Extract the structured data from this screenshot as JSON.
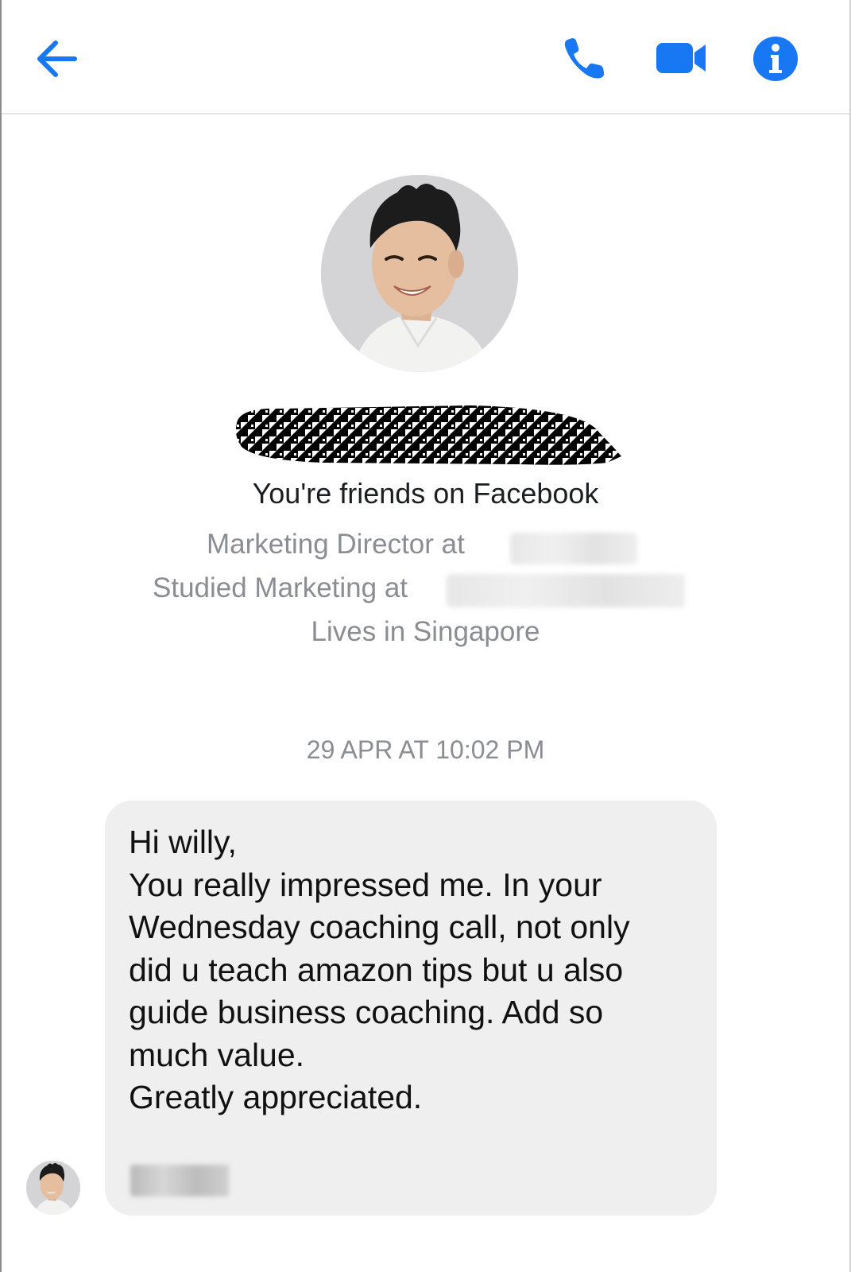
{
  "header": {
    "back_icon": "arrow-left-icon",
    "call_icon": "phone-icon",
    "video_icon": "video-camera-icon",
    "info_icon": "info-icon",
    "accent_color": "#1877f2"
  },
  "profile": {
    "name": "",
    "friends_text": "You're friends on Facebook",
    "work_text": "Marketing Director at",
    "study_text": "Studied Marketing at",
    "location_text": "Lives in Singapore"
  },
  "conversation": {
    "timestamp": "29 APR AT 10:02 PM",
    "messages": [
      {
        "text": "Hi willy,\nYou really impressed me. In your\nWednesday coaching call, not only\ndid u teach amazon tips but u also\nguide business coaching. Add so\nmuch value.\nGreatly appreciated."
      }
    ]
  }
}
